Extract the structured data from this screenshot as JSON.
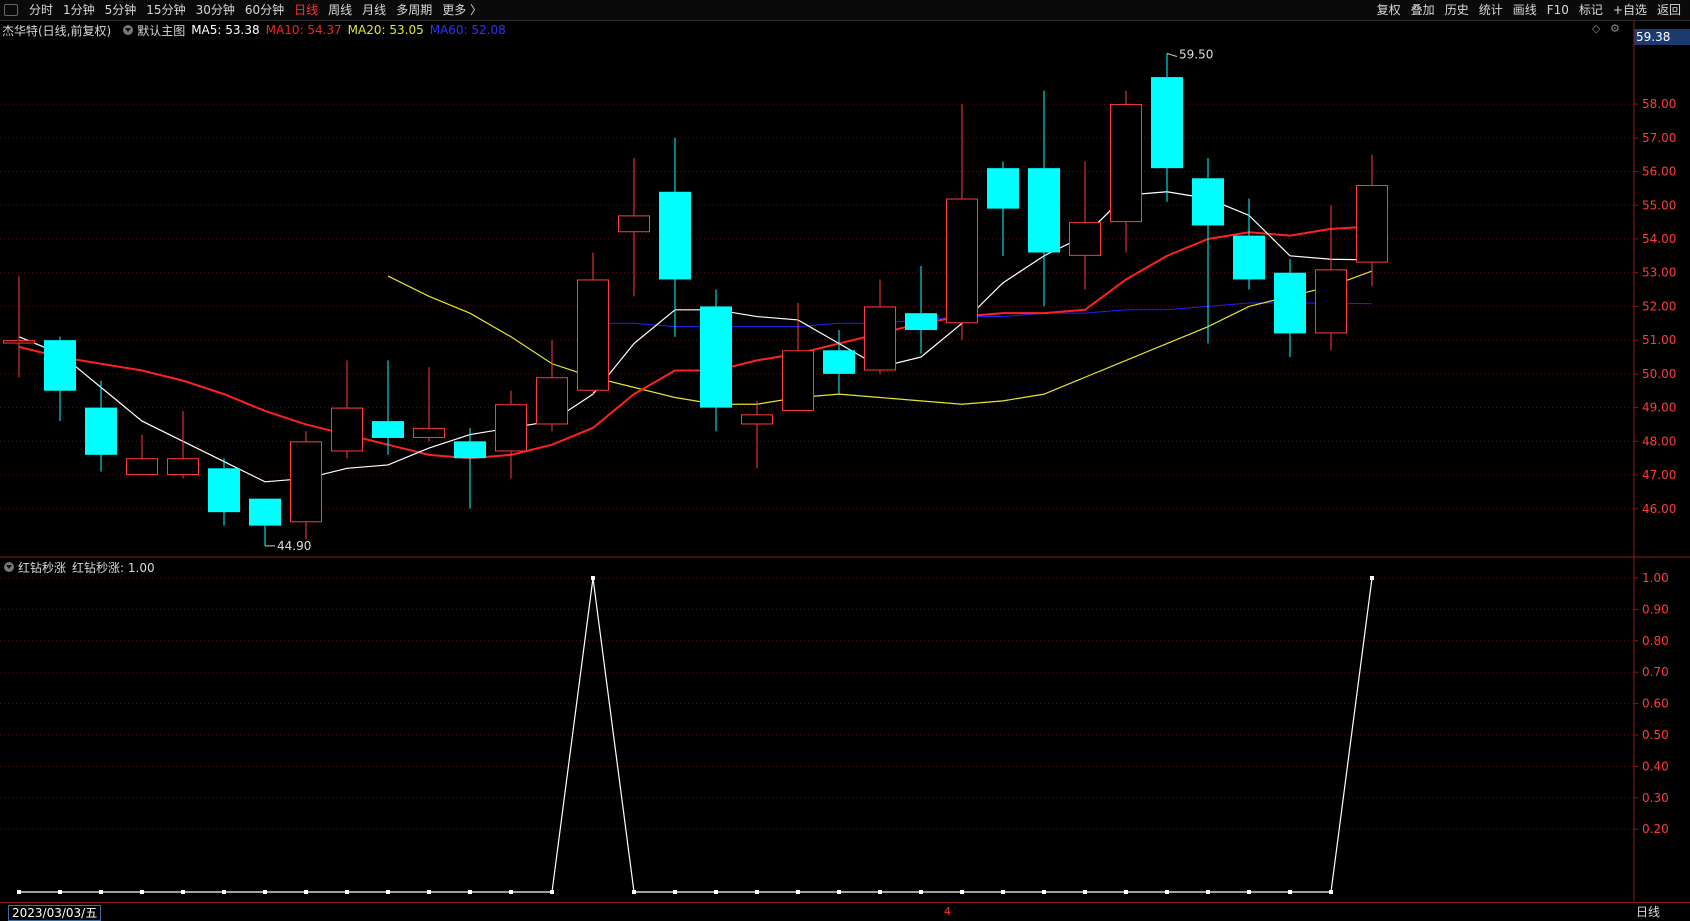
{
  "toolbar": {
    "left_items": [
      "分时",
      "1分钟",
      "5分钟",
      "15分钟",
      "30分钟",
      "60分钟",
      "日线",
      "周线",
      "月线",
      "多周期",
      "更多 〉"
    ],
    "active": "日线",
    "right_items": [
      "复权",
      "叠加",
      "历史",
      "统计",
      "画线",
      "F10",
      "标记",
      "+自选",
      "返回"
    ]
  },
  "main_legend": {
    "title": "杰华特(日线,前复权)",
    "indicator": "默认主图",
    "ma5": "MA5: 53.38",
    "ma10": "MA10: 54.37",
    "ma20": "MA20: 53.05",
    "ma60": "MA60: 52.08"
  },
  "sub_legend": {
    "name": "红钻秒涨",
    "value": "红钻秒涨: 1.00"
  },
  "current_price_tag": "59.38",
  "bottom": {
    "date": "2023/03/03/五",
    "period": "日线",
    "cursor_mark": "4"
  },
  "colors": {
    "up": "#ff3b3b",
    "down": "#00ffff",
    "ma5": "#ffffff",
    "ma10": "#ff2020",
    "ma20": "#e5e52a",
    "ma60": "#2020ff",
    "axis": "#8b1a1a",
    "grid": "#5a1010",
    "indicator": "#ffffff"
  },
  "chart_data": [
    {
      "type": "candlestick",
      "y_range": [
        44.6,
        59.9
      ],
      "y_ticks": [
        "58.00",
        "57.00",
        "56.00",
        "55.00",
        "54.00",
        "53.00",
        "52.00",
        "51.00",
        "50.00",
        "49.00",
        "48.00",
        "47.00",
        "46.00"
      ],
      "annotations": [
        {
          "label": "59.50",
          "index": 28,
          "value": 59.5,
          "kind": "high"
        },
        {
          "label": "44.90",
          "index": 6,
          "value": 44.9,
          "kind": "low"
        }
      ],
      "candles": [
        {
          "o": 50.9,
          "c": 51.0,
          "h": 52.9,
          "l": 49.9
        },
        {
          "o": 51.0,
          "c": 49.5,
          "h": 51.1,
          "l": 48.6
        },
        {
          "o": 49.0,
          "c": 47.6,
          "h": 49.8,
          "l": 47.1
        },
        {
          "o": 47.0,
          "c": 47.5,
          "h": 48.2,
          "l": 47.0
        },
        {
          "o": 47.0,
          "c": 47.5,
          "h": 48.9,
          "l": 46.9
        },
        {
          "o": 47.2,
          "c": 45.9,
          "h": 47.5,
          "l": 45.5
        },
        {
          "o": 46.3,
          "c": 45.5,
          "h": 46.3,
          "l": 44.9
        },
        {
          "o": 45.6,
          "c": 48.0,
          "h": 48.3,
          "l": 45.1
        },
        {
          "o": 47.7,
          "c": 49.0,
          "h": 50.4,
          "l": 47.5
        },
        {
          "o": 48.6,
          "c": 48.1,
          "h": 50.4,
          "l": 47.6
        },
        {
          "o": 48.1,
          "c": 48.4,
          "h": 50.2,
          "l": 48.0
        },
        {
          "o": 48.0,
          "c": 47.5,
          "h": 48.4,
          "l": 46.0
        },
        {
          "o": 47.7,
          "c": 49.1,
          "h": 49.5,
          "l": 46.9
        },
        {
          "o": 48.5,
          "c": 49.9,
          "h": 51.0,
          "l": 48.3
        },
        {
          "o": 49.5,
          "c": 52.8,
          "h": 53.6,
          "l": 49.4
        },
        {
          "o": 54.2,
          "c": 54.7,
          "h": 56.4,
          "l": 52.3
        },
        {
          "o": 55.4,
          "c": 52.8,
          "h": 57.0,
          "l": 51.1
        },
        {
          "o": 52.0,
          "c": 49.0,
          "h": 52.5,
          "l": 48.3
        },
        {
          "o": 48.5,
          "c": 48.8,
          "h": 49.2,
          "l": 47.2
        },
        {
          "o": 48.9,
          "c": 50.7,
          "h": 52.1,
          "l": 48.9
        },
        {
          "o": 50.7,
          "c": 50.0,
          "h": 51.3,
          "l": 49.4
        },
        {
          "o": 50.1,
          "c": 52.0,
          "h": 52.8,
          "l": 50.0
        },
        {
          "o": 51.8,
          "c": 51.3,
          "h": 53.2,
          "l": 50.6
        },
        {
          "o": 51.5,
          "c": 55.2,
          "h": 58.0,
          "l": 51.0
        },
        {
          "o": 56.1,
          "c": 54.9,
          "h": 56.3,
          "l": 53.5
        },
        {
          "o": 56.1,
          "c": 53.6,
          "h": 58.4,
          "l": 52.0
        },
        {
          "o": 53.5,
          "c": 54.5,
          "h": 56.3,
          "l": 52.5
        },
        {
          "o": 54.5,
          "c": 58.0,
          "h": 58.4,
          "l": 53.6
        },
        {
          "o": 58.8,
          "c": 56.1,
          "h": 59.5,
          "l": 55.1
        },
        {
          "o": 55.8,
          "c": 54.4,
          "h": 56.4,
          "l": 50.9
        },
        {
          "o": 54.1,
          "c": 52.8,
          "h": 55.2,
          "l": 52.5
        },
        {
          "o": 53.0,
          "c": 51.2,
          "h": 53.4,
          "l": 50.5
        },
        {
          "o": 51.2,
          "c": 53.1,
          "h": 55.0,
          "l": 50.7
        },
        {
          "o": 53.3,
          "c": 55.6,
          "h": 56.5,
          "l": 52.6
        }
      ],
      "ma5": [
        51.1,
        50.6,
        49.6,
        48.6,
        48.0,
        47.4,
        46.8,
        46.9,
        47.2,
        47.3,
        47.8,
        48.2,
        48.4,
        48.6,
        49.4,
        50.9,
        51.9,
        51.9,
        51.7,
        51.6,
        50.9,
        50.2,
        50.5,
        51.5,
        52.7,
        53.5,
        54.1,
        55.3,
        55.4,
        55.2,
        54.7,
        53.5,
        53.4,
        53.38
      ],
      "ma10": [
        50.8,
        50.5,
        50.3,
        50.1,
        49.8,
        49.4,
        48.9,
        48.5,
        48.2,
        47.9,
        47.6,
        47.5,
        47.6,
        47.9,
        48.4,
        49.4,
        50.1,
        50.1,
        50.4,
        50.6,
        50.9,
        51.2,
        51.5,
        51.7,
        51.8,
        51.8,
        51.9,
        52.8,
        53.5,
        54.0,
        54.2,
        54.1,
        54.3,
        54.37
      ],
      "ma20": [
        52.9,
        52.3,
        51.8,
        51.1,
        50.3,
        49.9,
        49.6,
        49.3,
        49.1,
        49.1,
        49.3,
        49.4,
        49.3,
        49.2,
        49.1,
        49.2,
        49.4,
        49.9,
        50.4,
        50.9,
        51.4,
        52.0,
        52.3,
        52.6,
        53.05
      ],
      "ma60": [
        51.5,
        51.5,
        51.4,
        51.4,
        51.4,
        51.4,
        51.5,
        51.5,
        51.6,
        51.7,
        51.7,
        51.8,
        51.8,
        51.9,
        51.9,
        52.0,
        52.1,
        52.1,
        52.1,
        52.08
      ]
    },
    {
      "type": "line",
      "name": "红钻秒涨",
      "y_range": [
        0,
        1.0
      ],
      "y_ticks": [
        "1.00",
        "0.90",
        "0.80",
        "0.70",
        "0.60",
        "0.50",
        "0.40",
        "0.30",
        "0.20"
      ],
      "values": [
        0,
        0,
        0,
        0,
        0,
        0,
        0,
        0,
        0,
        0,
        0,
        0,
        0,
        0,
        1,
        0,
        0,
        0,
        0,
        0,
        0,
        0,
        0,
        0,
        0,
        0,
        0,
        0,
        0,
        0,
        0,
        0,
        0,
        1
      ]
    }
  ]
}
